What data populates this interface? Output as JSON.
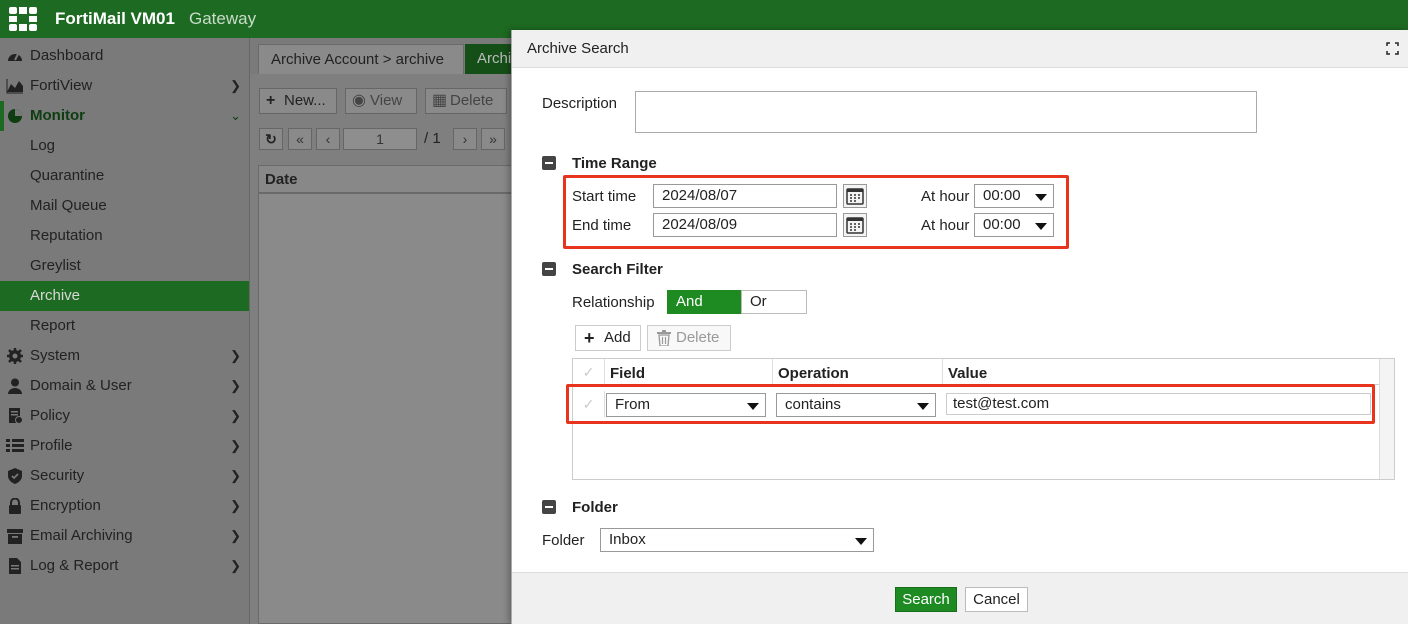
{
  "app": {
    "name": "FortiMail VM01",
    "mode": "Gateway"
  },
  "sidebar": {
    "items": [
      {
        "label": "Dashboard",
        "icon": "dashboard-icon"
      },
      {
        "label": "FortiView",
        "icon": "area-chart-icon"
      },
      {
        "label": "Monitor",
        "icon": "pie-chart-icon",
        "expanded": true
      },
      {
        "label": "Log"
      },
      {
        "label": "Quarantine"
      },
      {
        "label": "Mail Queue"
      },
      {
        "label": "Reputation"
      },
      {
        "label": "Greylist"
      },
      {
        "label": "Archive",
        "active": true
      },
      {
        "label": "Report"
      },
      {
        "label": "System",
        "icon": "gear-icon"
      },
      {
        "label": "Domain & User",
        "icon": "user-icon"
      },
      {
        "label": "Policy",
        "icon": "policy-icon"
      },
      {
        "label": "Profile",
        "icon": "list-icon"
      },
      {
        "label": "Security",
        "icon": "shield-icon"
      },
      {
        "label": "Encryption",
        "icon": "lock-icon"
      },
      {
        "label": "Email Archiving",
        "icon": "archive-box-icon"
      },
      {
        "label": "Log & Report",
        "icon": "document-icon"
      }
    ]
  },
  "background": {
    "tabs": [
      "Archive Account > archive",
      "Archi"
    ],
    "toolbar": {
      "new": "New...",
      "view": "View",
      "delete": "Delete"
    },
    "pager": {
      "page": "1",
      "total": "/ 1"
    },
    "grid_header": "Date"
  },
  "dialog": {
    "title": "Archive Search",
    "description_label": "Description",
    "description_value": "",
    "time_range": {
      "title": "Time Range",
      "start_label": "Start time",
      "start_value": "2024/08/07",
      "end_label": "End time",
      "end_value": "2024/08/09",
      "at_hour_label": "At hour",
      "start_hour": "00:00",
      "end_hour": "00:00"
    },
    "search_filter": {
      "title": "Search Filter",
      "relationship_label": "Relationship",
      "and": "And",
      "or": "Or",
      "add": "Add",
      "delete": "Delete",
      "columns": [
        "Field",
        "Operation",
        "Value"
      ],
      "rows": [
        {
          "field": "From",
          "operation": "contains",
          "value": "test@test.com"
        }
      ]
    },
    "folder": {
      "title": "Folder",
      "label": "Folder",
      "value": "Inbox"
    },
    "buttons": {
      "search": "Search",
      "cancel": "Cancel"
    }
  },
  "colors": {
    "brand": "#1d6a22",
    "highlight": "#e8341c",
    "primary_button": "#1d8a22"
  }
}
